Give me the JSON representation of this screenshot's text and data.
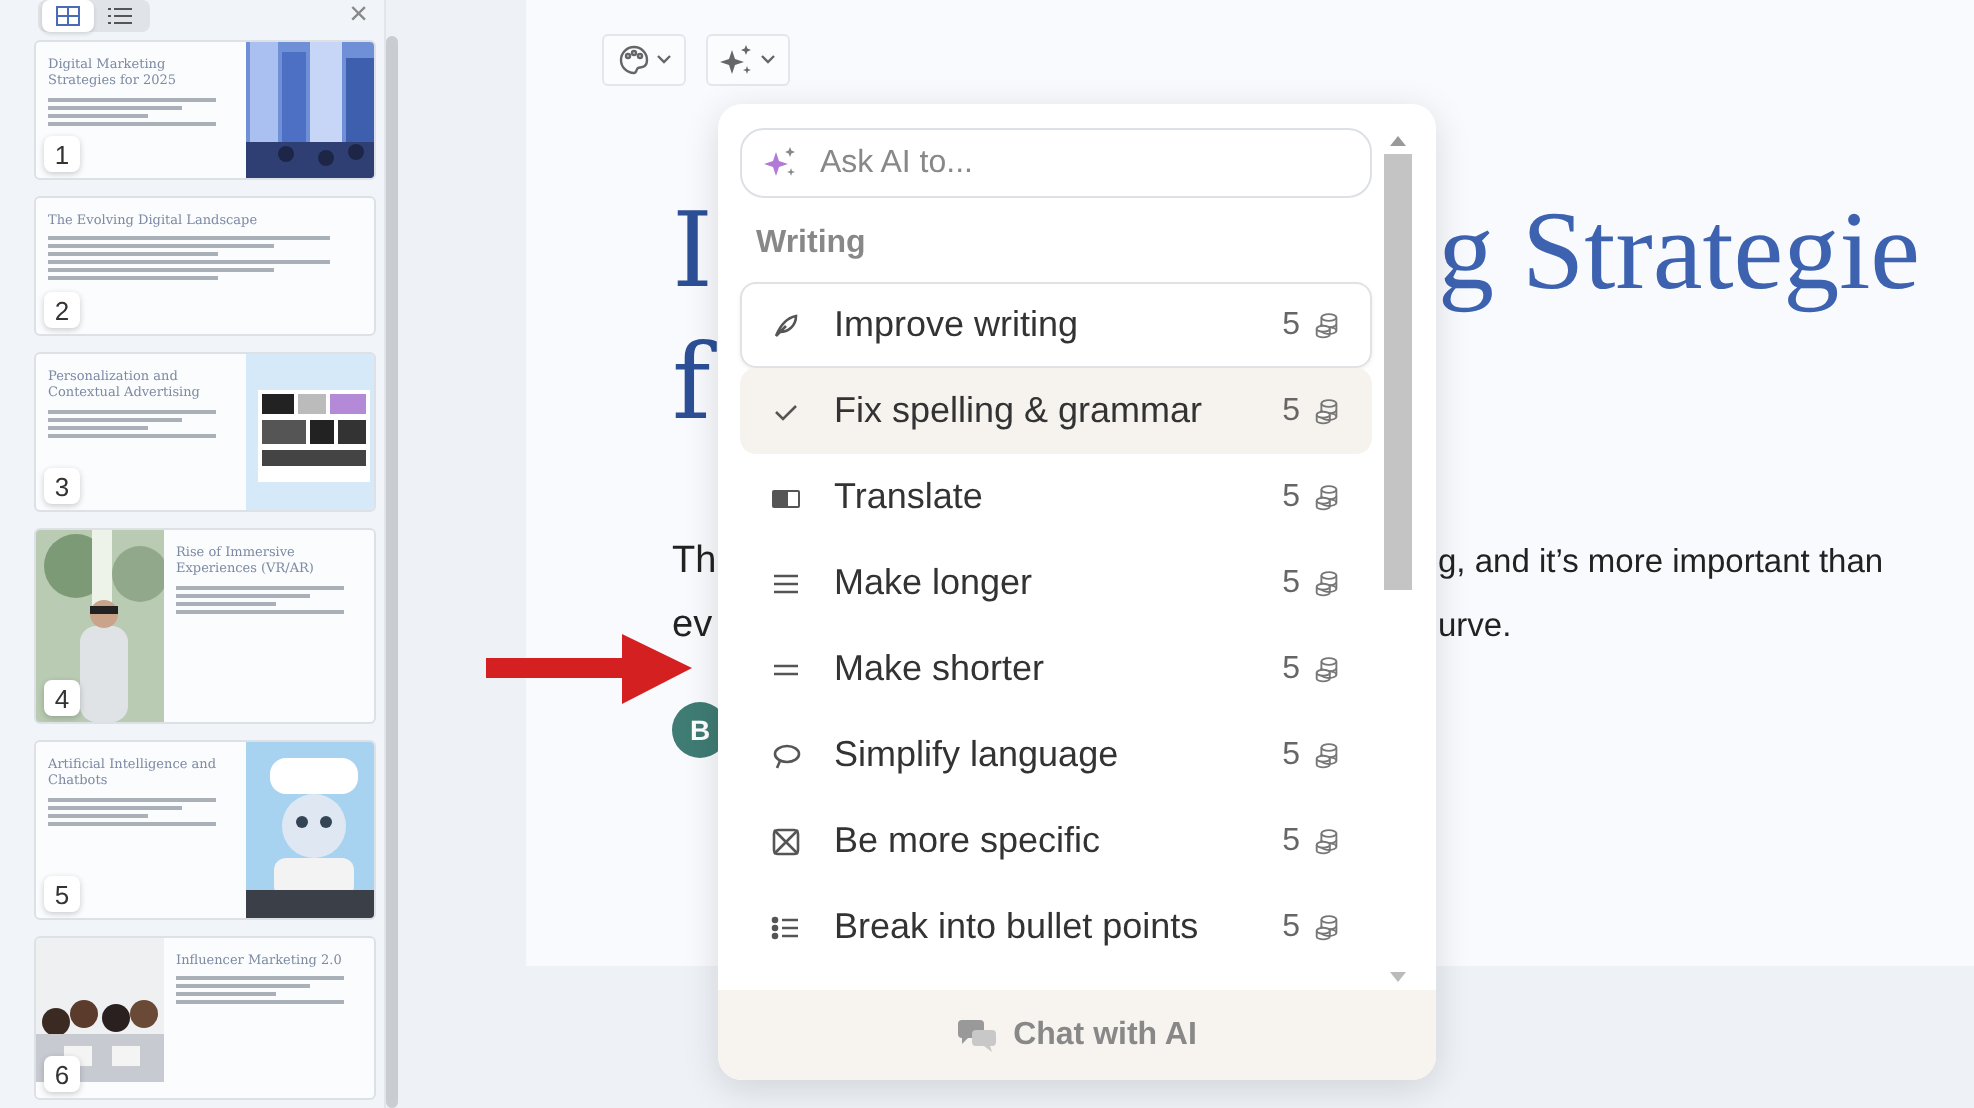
{
  "sidebar": {
    "view_toggle": [
      {
        "kind": "grid",
        "selected": true
      },
      {
        "kind": "list",
        "selected": false
      }
    ],
    "close": "×",
    "slides": [
      {
        "number": "1",
        "title": "Digital Marketing Strategies for 2025",
        "kind": "image_right"
      },
      {
        "number": "2",
        "title": "The Evolving Digital Landscape",
        "kind": "text"
      },
      {
        "number": "3",
        "title": "Personalization and Contextual Advertising",
        "kind": "image_right"
      },
      {
        "number": "4",
        "title": "Rise of Immersive Experiences (VR/AR)",
        "kind": "image_left"
      },
      {
        "number": "5",
        "title": "Artificial Intelligence and Chatbots",
        "kind": "image_right"
      },
      {
        "number": "6",
        "title": "Influencer Marketing 2.0",
        "kind": "image_left"
      }
    ]
  },
  "document": {
    "heading_left": [
      "I",
      "f"
    ],
    "heading_right": "g Strategie",
    "paragraph_left": [
      "Th",
      "ev"
    ],
    "paragraph_right": [
      "g, and it’s more important than",
      "urve."
    ],
    "avatar": "B"
  },
  "ai_menu": {
    "placeholder": "Ask AI to...",
    "section": "Writing",
    "items": [
      {
        "kind": "feather",
        "label": "Improve writing",
        "credits": "5",
        "focused": true,
        "selected": false
      },
      {
        "kind": "check",
        "label": "Fix spelling & grammar",
        "credits": "5",
        "focused": false,
        "selected": true
      },
      {
        "kind": "translate",
        "label": "Translate",
        "credits": "5",
        "focused": false,
        "selected": false
      },
      {
        "kind": "lines3",
        "label": "Make longer",
        "credits": "5",
        "focused": false,
        "selected": false
      },
      {
        "kind": "lines2",
        "label": "Make shorter",
        "credits": "5",
        "focused": false,
        "selected": false
      },
      {
        "kind": "speech",
        "label": "Simplify language",
        "credits": "5",
        "focused": false,
        "selected": false
      },
      {
        "kind": "target",
        "label": "Be more specific",
        "credits": "5",
        "focused": false,
        "selected": false
      },
      {
        "kind": "bullets",
        "label": "Break into bullet points",
        "credits": "5",
        "focused": false,
        "selected": false
      }
    ],
    "footer": "Chat with AI"
  }
}
